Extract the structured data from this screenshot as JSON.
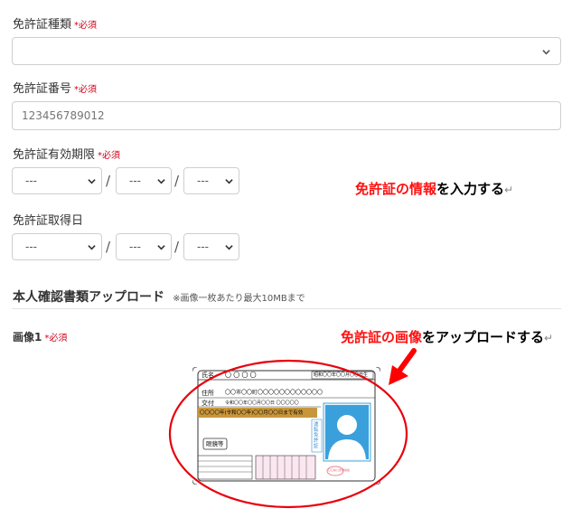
{
  "required_mark": "*必須",
  "license_type": {
    "label": "免許証種類",
    "value": ""
  },
  "license_number": {
    "label": "免許証番号",
    "placeholder": "123456789012"
  },
  "expiry": {
    "label": "免許証有効期限",
    "year": "---",
    "month": "---",
    "day": "---",
    "separator": "/"
  },
  "acquired": {
    "label": "免許証取得日",
    "year": "---",
    "month": "---",
    "day": "---",
    "separator": "/"
  },
  "annotation_info": {
    "highlight": "免許証の情報",
    "rest": "を入力する",
    "return_mark": "↵"
  },
  "upload_section": {
    "title": "本人確認書類アップロード",
    "note": "※画像一枚あたり最大10MBまで"
  },
  "image1": {
    "label": "画像1"
  },
  "annotation_image": {
    "highlight": "免許証の画像",
    "rest": "をアップロードする",
    "return_mark": "↵"
  },
  "license_card": {
    "name_label": "氏名",
    "name_value": "〇 〇 〇 〇",
    "birth_text": "昭和〇〇年〇〇月〇〇日生",
    "address_label": "住所",
    "address_value": "〇〇市〇〇町〇〇〇〇〇〇〇〇〇〇〇〇",
    "issue_label": "交付",
    "issue_value": "令和〇〇年〇〇月〇〇日  〇〇〇〇〇",
    "valid_banner": "〇〇〇〇年(令和〇〇年)〇〇月〇〇日まで有効",
    "condition_text": "眼鏡等",
    "blue_stamp": "運転免許証",
    "seal_text": "〇〇県公安委員会"
  },
  "colors": {
    "required": "#d0021b",
    "highlight": "#ff1010",
    "circle": "#e8000b",
    "arrow": "#ff0000"
  }
}
